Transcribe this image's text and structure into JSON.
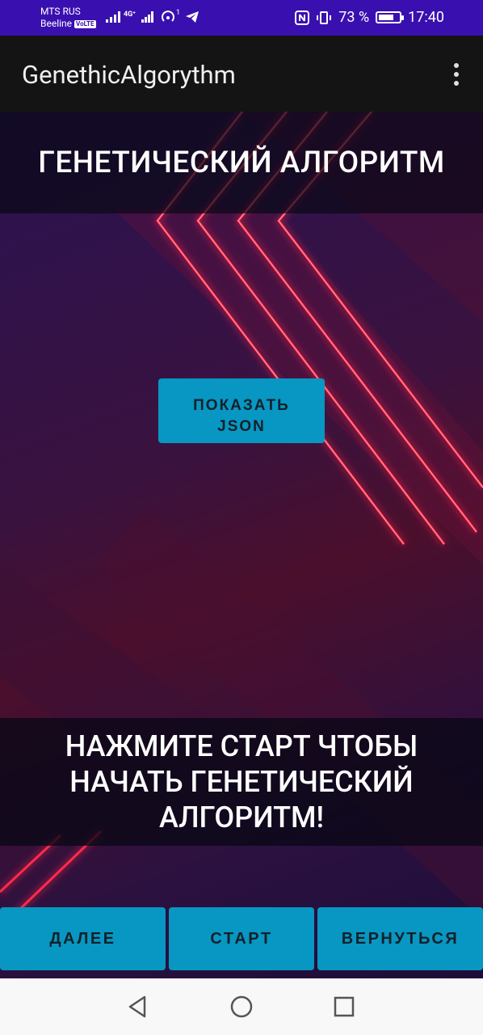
{
  "status_bar": {
    "carrier_1": "MTS RUS",
    "carrier_2": "Beeline",
    "volte": "VoLTE",
    "network": "4G⁺",
    "notification_count": "1",
    "battery": "73 %",
    "battery_level": 0.73,
    "time": "17:40"
  },
  "app_bar": {
    "title": "GenethicAlgorythm",
    "menu_icon": "more-vert-icon"
  },
  "main": {
    "title": "ГЕНЕТИЧЕСКИЙ АЛГОРИТМ",
    "show_json_button": "ПОКАЗАТЬ JSON",
    "message": "НАЖМИТЕ СТАРТ ЧТОБЫ НАЧАТЬ ГЕНЕТИЧЕСКИЙ АЛГОРИТМ!"
  },
  "buttons": {
    "next": "ДАЛЕЕ",
    "start": "СТАРТ",
    "back": "ВЕРНУТЬСЯ"
  },
  "colors": {
    "status_bar": "#3a0fb0",
    "app_bar": "#141414",
    "button": "#0797c2",
    "neon": "#ff2a4a"
  },
  "nav_bar": {
    "back_icon": "triangle-back-icon",
    "home_icon": "circle-home-icon",
    "recent_icon": "square-recent-icon"
  }
}
